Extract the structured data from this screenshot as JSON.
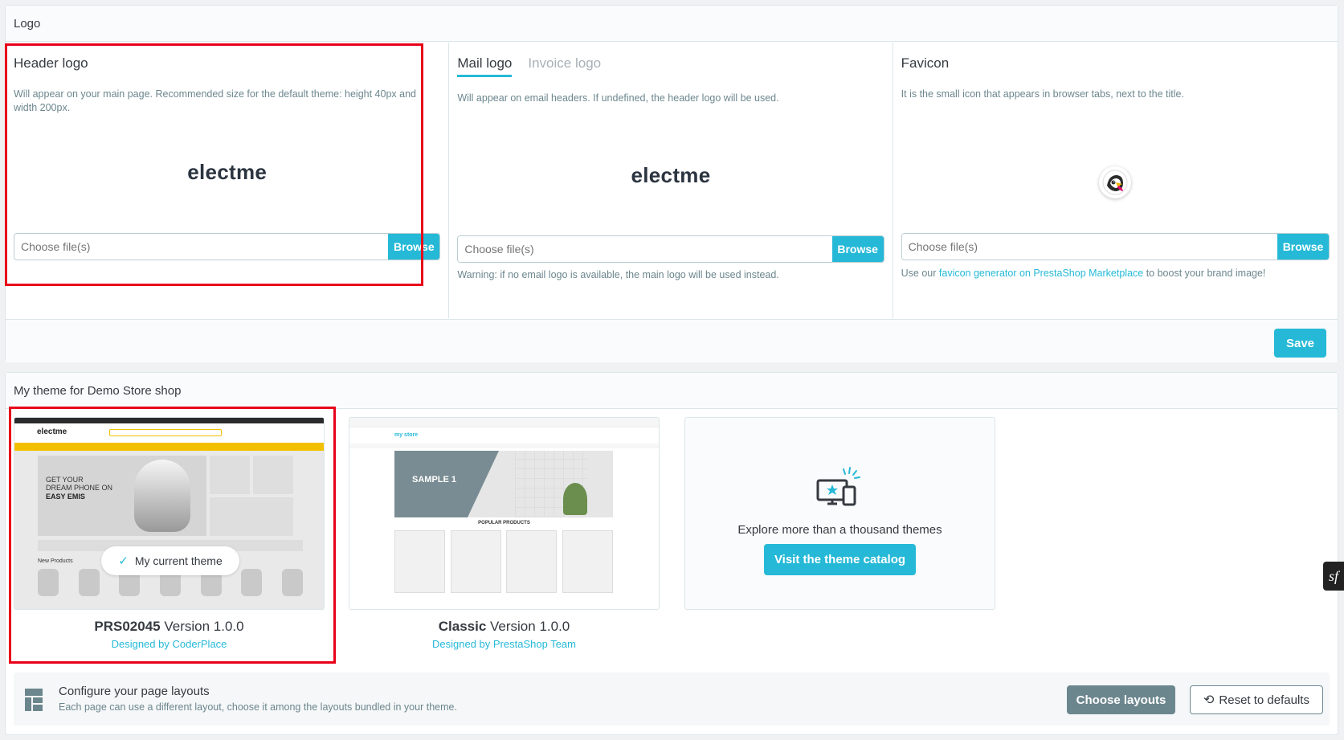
{
  "logo_section": {
    "title": "Logo",
    "header_logo": {
      "title": "Header logo",
      "description": "Will appear on your main page. Recommended size for the default theme: height 40px and width 200px.",
      "logo_text": "electme",
      "file_placeholder": "Choose file(s)",
      "browse_label": "Browse"
    },
    "mail_logo": {
      "tab_mail": "Mail logo",
      "tab_invoice": "Invoice logo",
      "description": "Will appear on email headers. If undefined, the header logo will be used.",
      "logo_text": "electme",
      "file_placeholder": "Choose file(s)",
      "browse_label": "Browse",
      "warning": "Warning: if no email logo is available, the main logo will be used instead."
    },
    "favicon": {
      "title": "Favicon",
      "description": "It is the small icon that appears in browser tabs, next to the title.",
      "icon": "prestashop-puffin-icon",
      "file_placeholder": "Choose file(s)",
      "browse_label": "Browse",
      "help_prefix": "Use our ",
      "help_link": "favicon generator on PrestaShop Marketplace",
      "help_suffix": " to boost your brand image!"
    },
    "save_label": "Save"
  },
  "theme_section": {
    "title": "My theme for Demo Store shop",
    "themes": [
      {
        "name": "PRS02045",
        "version": "Version 1.0.0",
        "author": "Designed by CoderPlace",
        "current_label": "My current theme",
        "preview": {
          "brand": "electme",
          "headline1": "GET YOUR",
          "headline2": "DREAM PHONE ON",
          "headline3": "EASY EMIS",
          "section": "New Products"
        }
      },
      {
        "name": "Classic",
        "version": "Version 1.0.0",
        "author": "Designed by PrestaShop Team",
        "preview": {
          "brand": "my store",
          "slide": "SAMPLE 1",
          "section": "POPULAR PRODUCTS"
        }
      }
    ],
    "explore_text": "Explore more than a thousand themes",
    "catalog_button": "Visit the theme catalog",
    "layouts": {
      "title": "Configure your page layouts",
      "description": "Each page can use a different layout, choose it among the layouts bundled in your theme.",
      "choose_label": "Choose layouts",
      "reset_label": "Reset to defaults"
    }
  },
  "colors": {
    "primary": "#25b9d7",
    "highlight": "#e8001a",
    "secondary": "#6c868e"
  }
}
